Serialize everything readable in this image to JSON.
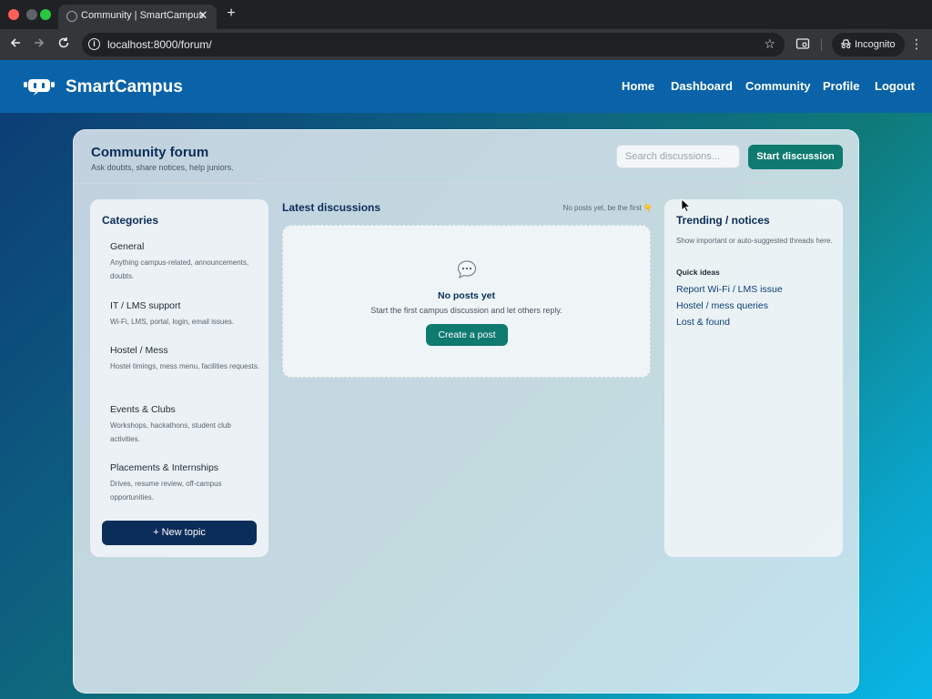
{
  "browser": {
    "tab_title": "Community | SmartCampus",
    "tab_close": "✕",
    "new_tab": "+",
    "url": "localhost:8000/forum/",
    "incognito_label": "Incognito",
    "icons": [
      "back-arrow-icon",
      "forward-arrow-icon",
      "reload-icon",
      "site-info-icon",
      "bookmark-star-icon",
      "extensions-icon",
      "incognito-icon",
      "kebab-menu-icon"
    ]
  },
  "navbar": {
    "brand": "SmartCampus",
    "links": [
      "Home",
      "Dashboard",
      "Community",
      "Profile",
      "Logout"
    ],
    "color": "#0a63a8"
  },
  "forum": {
    "title": "Community forum",
    "subtitle": "Ask doubts, share notices, help juniors.",
    "search_placeholder": "Search discussions...",
    "start_label": "Start discussion"
  },
  "categories": {
    "title": "Categories",
    "items": [
      {
        "name": "General",
        "desc": "Anything campus-related, announcements, doubts."
      },
      {
        "name": "IT / LMS support",
        "desc": "Wi-Fi, LMS, portal, login, email issues."
      },
      {
        "name": "Hostel / Mess",
        "desc": "Hostel timings, mess menu, facilities requests."
      },
      {
        "name": "Events & Clubs",
        "desc": "Workshops, hackathons, student club activities."
      },
      {
        "name": "Placements & Internships",
        "desc": "Drives, resume review, off-campus opportunities."
      }
    ],
    "new_topic_label": "+ New topic"
  },
  "latest": {
    "title": "Latest discussions",
    "note": "No posts yet, be the first 👇",
    "empty_title": "No posts yet",
    "empty_sub": "Start the first campus discussion and let others reply.",
    "create_label": "Create a post"
  },
  "trending": {
    "title": "Trending / notices",
    "subtitle": "Show important or auto-suggested threads here.",
    "quick_label": "Quick ideas",
    "links": [
      "Report Wi-Fi / LMS issue",
      "Hostel / mess queries",
      "Lost & found"
    ]
  },
  "colors": {
    "accent_teal": "#0f7a70",
    "navy": "#0b2d5a"
  }
}
